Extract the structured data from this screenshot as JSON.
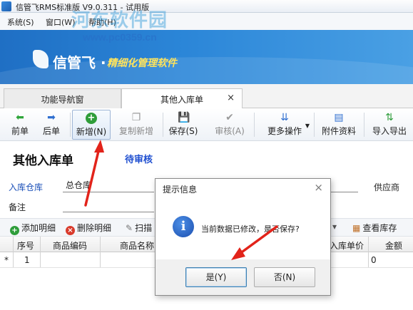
{
  "window": {
    "title": "信管飞RMS标准版 V9.0.311 - 试用版"
  },
  "watermark": {
    "site": "河东软件园",
    "url": "www.pc0359.cn"
  },
  "menu": {
    "items": [
      "系统(S)",
      "窗口(W)",
      "帮助(H)"
    ]
  },
  "banner": {
    "brand": "信管飞 ·",
    "slogan": "精细化管理软件"
  },
  "tabs": [
    {
      "label": "功能导航窗",
      "active": false
    },
    {
      "label": "其他入库单",
      "active": true,
      "close": "×"
    }
  ],
  "toolbar": {
    "items": [
      {
        "label": "前单",
        "icon": "arrow-left-icon"
      },
      {
        "label": "后单",
        "icon": "arrow-right-icon"
      },
      {
        "label": "新增(N)",
        "icon": "plus-circle-icon"
      },
      {
        "label": "复制新增",
        "icon": "copy-icon"
      },
      {
        "label": "保存(S)",
        "icon": "save-icon"
      },
      {
        "label": "审核(A)",
        "icon": "check-icon"
      },
      {
        "label": "更多操作",
        "icon": "double-chevron-down-icon"
      },
      {
        "label": "附件资料",
        "icon": "attachment-icon"
      },
      {
        "label": "导入导出",
        "icon": "import-export-icon"
      }
    ]
  },
  "form": {
    "title": "其他入库单",
    "status": "待审核",
    "warehouse_label": "入库仓库",
    "warehouse_value": "总仓库",
    "supplier_label": "供应商",
    "remark_label": "备注"
  },
  "grid_toolbar": {
    "add_detail": "添加明细",
    "delete_detail": "删除明细",
    "scan": "扫描",
    "view_stock": "查看库存",
    "colors": {
      "add": "#2e9d3a",
      "delete": "#d93a2b"
    }
  },
  "grid": {
    "headers": [
      "序号",
      "商品编码",
      "商品名称",
      "入库单价",
      "金额"
    ],
    "rows": [
      {
        "marker": "*",
        "no": "1",
        "amount": "0"
      }
    ]
  },
  "dialog": {
    "title": "提示信息",
    "close": "×",
    "message": "当前数据已修改，是否保存?",
    "yes": "是(Y)",
    "no": "否(N)"
  }
}
